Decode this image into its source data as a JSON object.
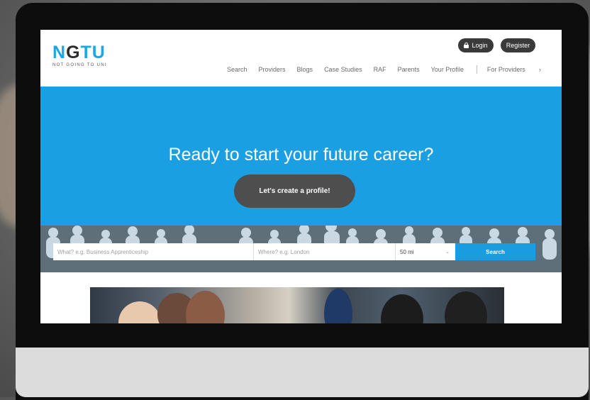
{
  "header": {
    "logo": {
      "text_main_a": "N",
      "text_main_g": "G",
      "text_main_b": "TU",
      "tagline": "NOT GOING TO UNI"
    },
    "login_label": "Login",
    "register_label": "Register",
    "nav": [
      "Search",
      "Providers",
      "Blogs",
      "Case Studies",
      "RAF",
      "Parents",
      "Your Profile"
    ],
    "for_providers_label": "For Providers",
    "for_providers_chevron": "›"
  },
  "hero": {
    "title": "Ready to start your future career?",
    "cta_label": "Let's create a profile!"
  },
  "search": {
    "what_placeholder": "What? e.g. Business Apprenticeship",
    "where_placeholder": "Where? e.g. London",
    "distance_value": "50 mi",
    "distance_caret": "⌄",
    "search_label": "Search"
  },
  "colors": {
    "brand_blue": "#1aa0e2",
    "dark_button": "#3a3a3a",
    "cta_gray": "#4e4e4e"
  },
  "icons": [
    "lock-icon",
    "chevron-right-icon",
    "chevron-down-icon"
  ]
}
